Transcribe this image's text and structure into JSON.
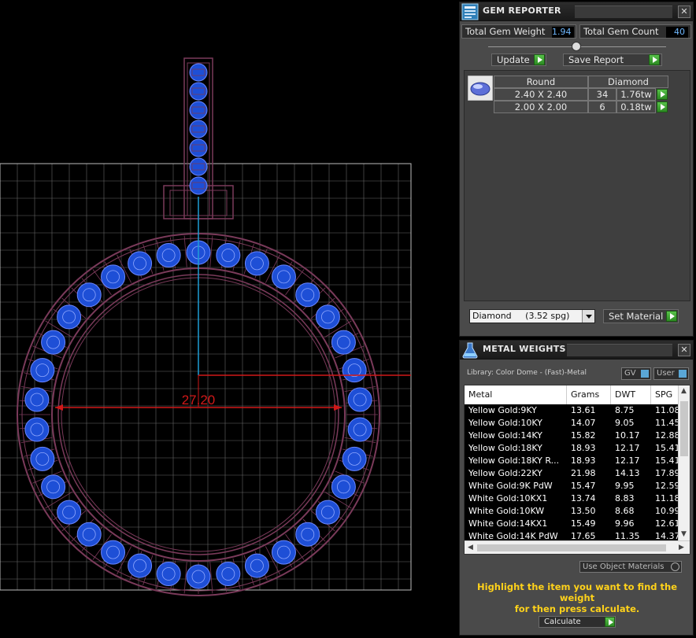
{
  "viewport": {
    "dimension": "27.20",
    "colors": {
      "grid": "#8a8a8a",
      "metal": "#7a3a5a",
      "gem": "#1e4fd6",
      "dim_line": "#d01818",
      "axis_blue": "#1e9ed6"
    }
  },
  "gem_reporter": {
    "title": "GEM REPORTER",
    "total_weight_label": "Total Gem Weight",
    "total_weight_value": "1.94",
    "total_count_label": "Total Gem Count",
    "total_count_value": "40",
    "update_label": "Update",
    "save_report_label": "Save Report",
    "shape_header": "Round",
    "material_header": "Diamond",
    "rows": [
      {
        "size": "2.40 X 2.40",
        "count": "34",
        "weight": "1.76tw"
      },
      {
        "size": "2.00 X 2.00",
        "count": "6",
        "weight": "0.18tw"
      }
    ],
    "material_select": "Diamond     (3.52 spg)",
    "set_material_label": "Set Material"
  },
  "metal_weights": {
    "title": "METAL WEIGHTS",
    "library": "Library: Color Dome - (Fast)-Metal",
    "gv_label": "GV",
    "user_label": "User",
    "columns": [
      "Metal",
      "Grams",
      "DWT",
      "SPG"
    ],
    "rows": [
      [
        "Yellow Gold:9KY",
        "13.61",
        "8.75",
        "11.08"
      ],
      [
        "Yellow Gold:10KY",
        "14.07",
        "9.05",
        "11.45"
      ],
      [
        "Yellow Gold:14KY",
        "15.82",
        "10.17",
        "12.88"
      ],
      [
        "Yellow Gold:18KY",
        "18.93",
        "12.17",
        "15.41"
      ],
      [
        "Yellow Gold:18KY R...",
        "18.93",
        "12.17",
        "15.41"
      ],
      [
        "Yellow Gold:22KY",
        "21.98",
        "14.13",
        "17.89"
      ],
      [
        "White Gold:9K PdW",
        "15.47",
        "9.95",
        "12.59"
      ],
      [
        "White Gold:10KX1",
        "13.74",
        "8.83",
        "11.18"
      ],
      [
        "White Gold:10KW",
        "13.50",
        "8.68",
        "10.99"
      ],
      [
        "White Gold:14KX1",
        "15.49",
        "9.96",
        "12.61"
      ],
      [
        "White Gold:14K PdW",
        "17.65",
        "11.35",
        "14.37"
      ]
    ],
    "use_object_materials_label": "Use Object Materials",
    "hint_line1": "Highlight the item you want to find the weight",
    "hint_line2": "for then press calculate.",
    "calculate_label": "Calculate"
  }
}
